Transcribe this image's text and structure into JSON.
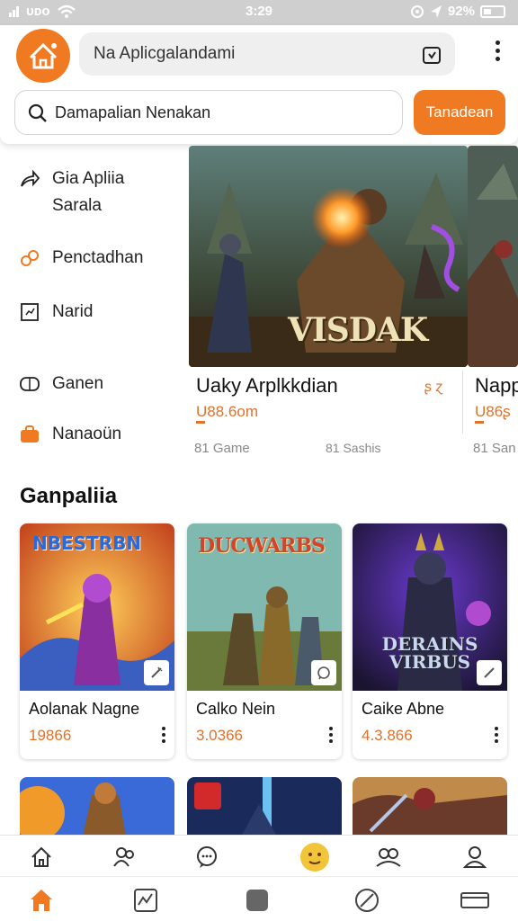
{
  "status_bar": {
    "carrier": "ᴜᴅᴏ",
    "time": "3:29",
    "battery": "92%"
  },
  "header": {
    "app_title": "Na Aplicgalandami",
    "search_placeholder": "Damapalian Nenakan",
    "search_button": "Tanadean"
  },
  "sidebar": {
    "items": [
      {
        "label_line1": "Gia Apliia",
        "label_line2": "Sarala",
        "icon": "share-arrow-icon"
      },
      {
        "label": "Penctadhan",
        "icon": "link-icon"
      },
      {
        "label": "Narid",
        "icon": "chart-box-icon"
      },
      {
        "label": "Ganen",
        "icon": "gamepad-icon"
      },
      {
        "label": "Nanaoün",
        "icon": "briefcase-icon"
      }
    ]
  },
  "featured": {
    "art_title": "VISDAK",
    "cards": [
      {
        "name": "Uaky Arplkkdian",
        "price": "U88.6om",
        "meta1": "81 Game",
        "meta2": "81 Sashis",
        "tag": "ʂ ɀ"
      },
      {
        "name": "Napp",
        "price": "U86ʂ",
        "meta1": "81 San"
      }
    ]
  },
  "section": {
    "title": "Ganpaliia"
  },
  "grid": [
    {
      "name": "Aolanak Nagne",
      "price": "19866",
      "art_text": "NBESTRBN"
    },
    {
      "name": "Calko Nein",
      "price": "3.0366",
      "art_text": "DUCWARBS"
    },
    {
      "name": "Caike Abne",
      "price": "4.3.866",
      "art_text": "DERAINS VIRBUS"
    }
  ],
  "colors": {
    "accent": "#f07a22",
    "price": "#e2712a",
    "status_bar": "#cfcfcf"
  },
  "tabbar_top": [
    "home-outline-icon",
    "users-icon",
    "chat-bubble-icon",
    "emoji-badge-icon",
    "group-icon",
    "profile-icon"
  ],
  "tabbar_bottom": [
    "home-filled-icon",
    "activity-icon",
    "square-icon",
    "compass-icon",
    "window-icon"
  ]
}
